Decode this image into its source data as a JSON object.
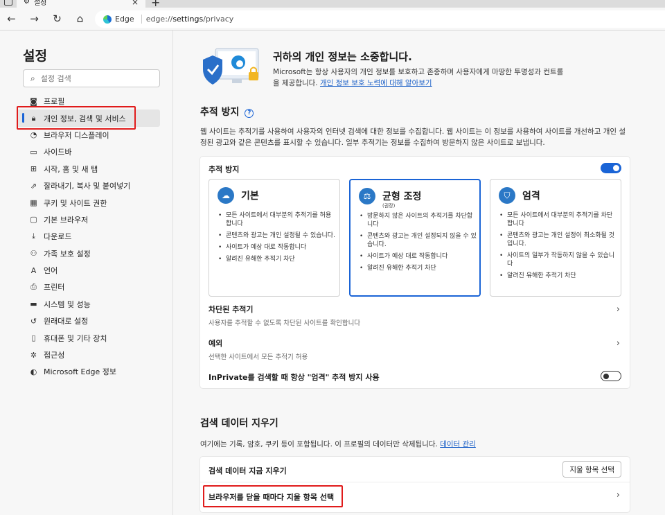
{
  "tab": {
    "title": "설정"
  },
  "address": {
    "chip_label": "Edge",
    "url_prefix": "edge://",
    "url_host": "settings",
    "url_path": "/privacy"
  },
  "sidebar": {
    "title": "설정",
    "search_placeholder": "설정 검색",
    "items": [
      {
        "label": "프로필",
        "icon": "profile-icon"
      },
      {
        "label": "개인 정보, 검색 및 서비스",
        "icon": "lock-icon",
        "active": true
      },
      {
        "label": "브라우저 디스플레이",
        "icon": "appearance-icon"
      },
      {
        "label": "사이드바",
        "icon": "sidebar-icon"
      },
      {
        "label": "시작, 홈 및 새 탭",
        "icon": "start-icon"
      },
      {
        "label": "잘라내기, 복사 및 붙여넣기",
        "icon": "share-icon"
      },
      {
        "label": "쿠키 및 사이트 권한",
        "icon": "cookie-icon"
      },
      {
        "label": "기본 브라우저",
        "icon": "browser-icon"
      },
      {
        "label": "다운로드",
        "icon": "download-icon"
      },
      {
        "label": "가족 보호 설정",
        "icon": "family-icon"
      },
      {
        "label": "언어",
        "icon": "language-icon"
      },
      {
        "label": "프린터",
        "icon": "printer-icon"
      },
      {
        "label": "시스템 및 성능",
        "icon": "system-icon"
      },
      {
        "label": "원래대로 설정",
        "icon": "reset-icon"
      },
      {
        "label": "휴대폰 및 기타 장치",
        "icon": "phone-icon"
      },
      {
        "label": "접근성",
        "icon": "accessibility-icon"
      },
      {
        "label": "Microsoft Edge 정보",
        "icon": "edge-icon"
      }
    ]
  },
  "hero": {
    "title": "귀하의 개인 정보는 소중합니다.",
    "desc": "Microsoft는 항상 사용자의 개인 정보를 보호하고 존중하며 사용자에게 마땅한 투명성과 컨트롤을 제공합니다.",
    "link": "개인 정보 보호 노력에 대해 알아보기"
  },
  "tracking": {
    "title": "추적 방지",
    "desc": "웹 사이트는 추적기를 사용하여 사용자의 인터넷 검색에 대한 정보를 수집합니다. 웹 사이트는 이 정보를 사용하여 사이트를 개선하고 개인 설정된 광고와 같은 콘텐츠를 표시할 수 있습니다. 일부 추적기는 정보를 수집하여 방문하지 않은 사이트로 보냅니다.",
    "toggle_label": "추적 방지",
    "toggle_on": true,
    "options": [
      {
        "title": "기본",
        "sub": "",
        "icon": "basic-icon",
        "bullets": [
          "모든 사이트에서 대부분의 추적기를 허용합니다",
          "콘텐츠와 광고는 개인 설정될 수 있습니다.",
          "사이트가 예상 대로 작동합니다",
          "알려진 유해한 추적기 차단"
        ]
      },
      {
        "title": "균형 조정",
        "sub": "(권장)",
        "icon": "balanced-icon",
        "selected": true,
        "bullets": [
          "방문하지 않은 사이트의 추적기를 차단합니다",
          "콘텐츠와 광고는 개인 설정되지 않을 수 있습니다.",
          "사이트가 예상 대로 작동합니다",
          "알려진 유해한 추적기 차단"
        ]
      },
      {
        "title": "엄격",
        "sub": "",
        "icon": "strict-icon",
        "bullets": [
          "모든 사이트에서 대부분의 추적기를 차단합니다",
          "콘텐츠와 광고는 개인 설정이 최소화될 것입니다.",
          "사이트의 일부가 작동하지 않을 수 있습니다",
          "알려진 유해한 추적기 차단"
        ]
      }
    ],
    "blocked_label": "차단된 추적기",
    "blocked_sub": "사용자를 추적할 수 없도록 차단된 사이트를 확인합니다",
    "exceptions_label": "예외",
    "exceptions_sub": "선택한 사이트에서 모든 추적기 허용",
    "inprivate_label": "InPrivate를 검색할 때 항상 \"엄격\" 추적 방지 사용",
    "inprivate_on": false
  },
  "clear": {
    "title": "검색 데이터 지우기",
    "desc": "여기에는 기록, 암호, 쿠키 등이 포함됩니다. 이 프로필의 데이터만 삭제됩니다.",
    "link": "데이터 관리",
    "now_label": "검색 데이터 지금 지우기",
    "choose_button": "지울 항목 선택",
    "on_close_label": "브라우저를 닫을 때마다 지울 항목 선택"
  },
  "colors": {
    "accent": "#1a64d6",
    "highlight": "#e01b1b"
  }
}
